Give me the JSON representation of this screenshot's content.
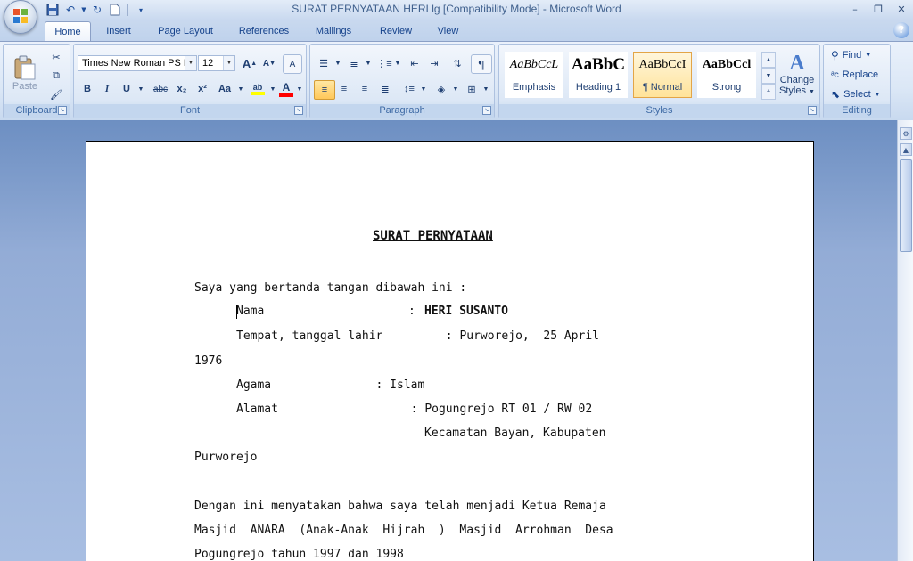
{
  "window": {
    "title": "SURAT PERNYATAAN HERI lg [Compatibility Mode] - Microsoft Word",
    "office_button_icon": "office-logo-icon",
    "quick_access": [
      "save-icon",
      "undo-icon",
      "redo-icon",
      "new-document-icon",
      "customize-qat-icon"
    ],
    "controls": {
      "minimize": "–",
      "restore": "❐",
      "close": "✕"
    },
    "help": "?"
  },
  "tabs": [
    {
      "label": "Home",
      "active": true
    },
    {
      "label": "Insert"
    },
    {
      "label": "Page Layout"
    },
    {
      "label": "References"
    },
    {
      "label": "Mailings"
    },
    {
      "label": "Review"
    },
    {
      "label": "View"
    }
  ],
  "ribbon": {
    "clipboard": {
      "label": "Clipboard",
      "paste": "Paste"
    },
    "font": {
      "label": "Font",
      "font_name": "Times New Roman PS M",
      "font_size": "12",
      "grow": "A",
      "shrink": "A",
      "clear": "A",
      "bold": "B",
      "italic": "I",
      "underline": "U",
      "strike": "abc",
      "subscript": "x₂",
      "superscript": "x²",
      "change_case": "Aa",
      "highlight": "ab",
      "font_color": "A",
      "highlight_color": "#ffff00",
      "font_color_value": "#ff0000"
    },
    "paragraph": {
      "label": "Paragraph",
      "pilcrow": "¶"
    },
    "styles": {
      "label": "Styles",
      "items": [
        {
          "sample": "AaBbCcL",
          "name": "Emphasis"
        },
        {
          "sample": "AaBbC",
          "name": "Heading 1"
        },
        {
          "sample": "AaBbCcI",
          "name": "¶ Normal",
          "selected": true
        },
        {
          "sample": "AaBbCcl",
          "name": "Strong"
        }
      ],
      "change_styles_line1": "Change",
      "change_styles_line2": "Styles"
    },
    "editing": {
      "label": "Editing",
      "find": "Find",
      "replace": "Replace",
      "select": "Select"
    }
  },
  "document": {
    "title": "SURAT PERNYATAAN",
    "intro": "Saya yang bertanda tangan dibawah ini :",
    "nama_label": "Nama",
    "nama_sep": ":",
    "nama_value": "HERI SUSANTO",
    "ttl_line": "Tempat, tanggal lahir         : Purworejo,  25 April",
    "ttl_cont": "1976",
    "agama_line": "Agama               : Islam",
    "alamat_line": "Alamat                   : Pogungrejo RT 01 / RW 02",
    "alamat_cont1": "Kecamatan Bayan, Kabupaten",
    "alamat_cont2": "Purworejo",
    "para1_line1": "Dengan ini menyatakan bahwa saya telah menjadi Ketua Remaja",
    "para1_line2": "Masjid  ANARA  (Anak-Anak  Hijrah  )  Masjid  Arrohman  Desa",
    "para1_line3": "Pogungrejo tahun 1997 dan 1998"
  }
}
